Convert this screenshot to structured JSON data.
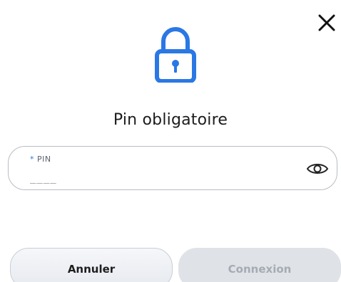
{
  "dialog": {
    "title": "Pin obligatoire",
    "close_icon": "close-icon",
    "lock_icon": "lock-icon",
    "accent_color": "#2a78e4"
  },
  "pin_field": {
    "required_marker": "*",
    "label": "PIN",
    "placeholder": "____",
    "value": "",
    "toggle_icon": "eye-icon"
  },
  "actions": {
    "cancel_label": "Annuler",
    "connect_label": "Connexion"
  }
}
